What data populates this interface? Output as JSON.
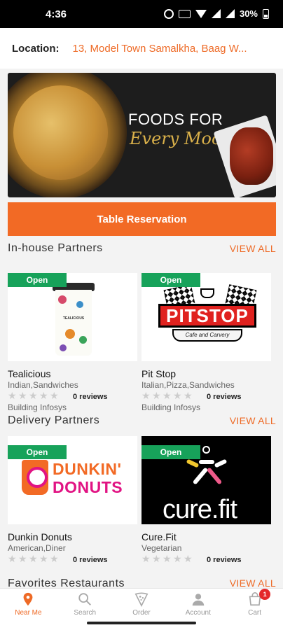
{
  "status": {
    "time": "4:36",
    "battery": "30%"
  },
  "location": {
    "label": "Location:",
    "value": "13, Model Town Samalkha, Baag W..."
  },
  "banner": {
    "title": "FOODS FOR",
    "subtitle": "Every Mood"
  },
  "reservation": {
    "label": "Table Reservation"
  },
  "in_house": {
    "title": "In-house Partners",
    "view_all": "VIEW ALL",
    "cards": [
      {
        "badge": "Open",
        "name": "Tealicious",
        "cuisine": "Indian,Sandwiches",
        "reviews": "0 reviews",
        "address": "Building Infosys",
        "img_text": "TEALICIOUS"
      },
      {
        "badge": "Open",
        "name": "Pit Stop",
        "cuisine": "Italian,Pizza,Sandwiches",
        "reviews": "0 reviews",
        "address": "Building Infosys",
        "img_text": "PITSTOP",
        "img_sub": "Cafe and Carvery"
      }
    ]
  },
  "delivery": {
    "title": "Delivery Partners",
    "view_all": "VIEW ALL",
    "cards": [
      {
        "badge": "Open",
        "name": "Dunkin Donuts",
        "cuisine": "American,Diner",
        "reviews": "0 reviews",
        "img_text1": "DUNKIN'",
        "img_text2": "DONUTS"
      },
      {
        "badge": "Open",
        "name": "Cure.Fit",
        "cuisine": "Vegetarian",
        "reviews": "0 reviews",
        "img_text": "cure.fit"
      }
    ]
  },
  "favorites": {
    "title": "Favorites Restaurants",
    "view_all": "VIEW ALL"
  },
  "nav": {
    "items": [
      {
        "label": "Near Me",
        "icon": "location-pin-icon",
        "active": true
      },
      {
        "label": "Search",
        "icon": "search-icon",
        "active": false
      },
      {
        "label": "Order",
        "icon": "pizza-icon",
        "active": false
      },
      {
        "label": "Account",
        "icon": "user-icon",
        "active": false
      },
      {
        "label": "Cart",
        "icon": "cart-icon",
        "active": false
      }
    ],
    "cart_count": "1"
  },
  "colors": {
    "accent": "#f26a25",
    "open_badge": "#17a25a",
    "view_all": "#ee6a26"
  }
}
